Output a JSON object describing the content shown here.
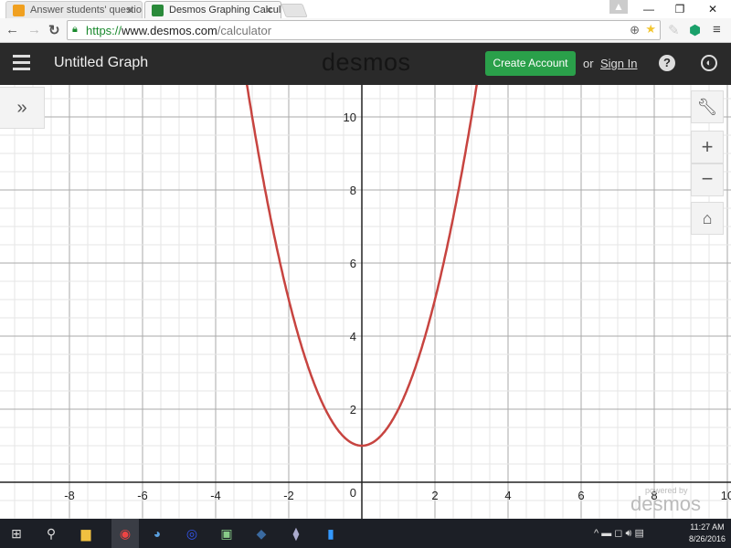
{
  "browser": {
    "tabs": [
      {
        "label": "Answer students' questio",
        "active": false
      },
      {
        "label": "Desmos Graphing Calcula",
        "active": true
      }
    ],
    "url_scheme": "https://",
    "url_domain": "www.desmos.com",
    "url_path": "/calculator"
  },
  "header": {
    "menu_icon": "hamburger-icon",
    "title": "Untitled Graph",
    "logo": "desmos",
    "create_account": "Create Account",
    "or": "or",
    "sign_in": "Sign In",
    "accent": "#2aa04a"
  },
  "graph": {
    "expression": "y = x^2 + 1",
    "curve_color": "#c74440",
    "xlim": [
      -9.9,
      10.1
    ],
    "ylim": [
      -1,
      10.875
    ],
    "x_ticks": [
      "-8",
      "-6",
      "-4",
      "-2",
      "2",
      "4",
      "6",
      "8",
      "10"
    ],
    "y_ticks": [
      "2",
      "4",
      "6",
      "8",
      "10"
    ],
    "origin_label": "0",
    "watermark_small": "powered by",
    "watermark": "desmos"
  },
  "taskbar": {
    "time": "11:27 AM",
    "date": "8/26/2016"
  }
}
